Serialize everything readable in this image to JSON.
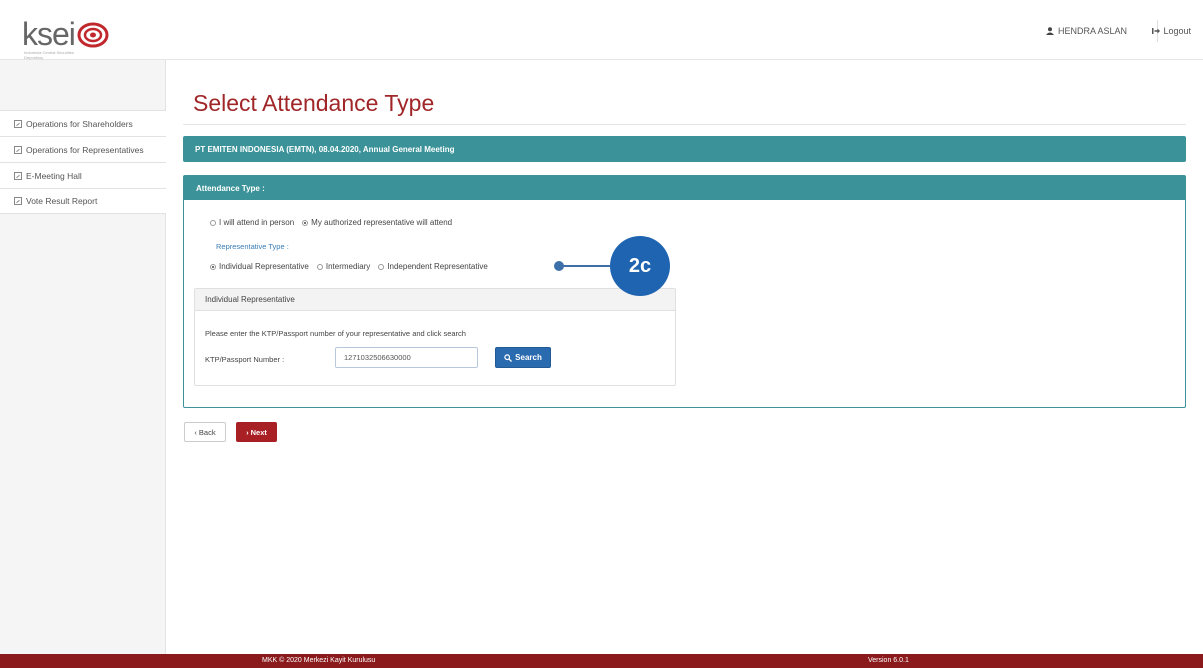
{
  "header": {
    "logo_text": "ksei",
    "logo_subtitle": "Indonesia Central Securities Depository",
    "user_name": "HENDRA ASLAN",
    "logout_label": "Logout"
  },
  "sidebar": {
    "items": [
      {
        "label": "Operations for Shareholders"
      },
      {
        "label": "Operations for Representatives"
      },
      {
        "label": "E-Meeting Hall"
      },
      {
        "label": "Vote Result Report"
      }
    ]
  },
  "main": {
    "page_title": "Select Attendance Type",
    "meeting_info": "PT EMITEN INDONESIA (EMTN), 08.04.2020, Annual General Meeting",
    "attendance_panel": {
      "title": "Attendance Type :",
      "options": [
        {
          "label": "I will attend in person",
          "selected": false
        },
        {
          "label": "My authorized representative will attend",
          "selected": true
        }
      ],
      "representative_type_label": "Representative Type :",
      "representative_options": [
        {
          "label": "Individual Representative",
          "selected": true
        },
        {
          "label": "Intermediary",
          "selected": false
        },
        {
          "label": "Independent Representative",
          "selected": false
        }
      ]
    },
    "individual_panel": {
      "title": "Individual Representative",
      "instruction": "Please enter the KTP/Passport number of your representative and click search",
      "ktp_label": "KTP/Passport Number :",
      "ktp_value": "1271032506630000",
      "search_label": "Search"
    },
    "back_label": "Back",
    "next_label": "Next"
  },
  "annotation": {
    "label": "2c"
  },
  "footer": {
    "copyright": "MKK © 2020 Merkezi Kayit Kurulusu",
    "version": "Version 6.0.1"
  },
  "colors": {
    "brand_red": "#a02628",
    "teal": "#3b9399",
    "button_blue": "#2a6bb0",
    "annotation_blue": "#1f64b0",
    "footer": "#8a1a1c"
  }
}
